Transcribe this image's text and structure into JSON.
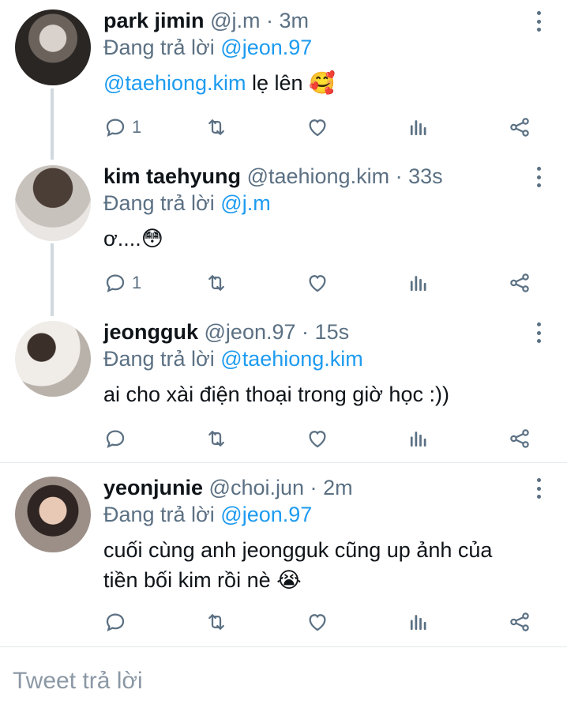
{
  "reply_prefix": "Đang trả lời",
  "tweets": [
    {
      "name": "park jimin",
      "handle": "@j.m",
      "dot": "·",
      "time": "3m",
      "reply_to": "@jeon.97",
      "body_mention": "@taehiong.kim",
      "body_text": " lẹ lên 🥰",
      "reply_count": "1"
    },
    {
      "name": "kim taehyung",
      "handle": "@taehiong.kim",
      "dot": "·",
      "time": "33s",
      "reply_to": "@j.m",
      "body_mention": "",
      "body_text": "ơ....😳",
      "reply_count": "1"
    },
    {
      "name": "jeongguk",
      "handle": "@jeon.97",
      "dot": "·",
      "time": "15s",
      "reply_to": "@taehiong.kim",
      "body_mention": "",
      "body_text": "ai cho xài điện thoại trong giờ học :))",
      "reply_count": ""
    },
    {
      "name": "yeonjunie",
      "handle": "@choi.jun",
      "dot": "·",
      "time": "2m",
      "reply_to": "@jeon.97",
      "body_mention": "",
      "body_text": "cuối cùng anh jeongguk cũng up ảnh của tiền bối kim rồi nè 😭",
      "reply_count": ""
    }
  ],
  "compose": {
    "placeholder": "Tweet trả lời"
  },
  "colors": {
    "accent": "#1d9bf0",
    "secondary_text": "#5b7083",
    "thread_line": "#cfd9de"
  },
  "icons": [
    "reply-icon",
    "retweet-icon",
    "like-icon",
    "analytics-icon",
    "share-icon",
    "more-icon"
  ]
}
